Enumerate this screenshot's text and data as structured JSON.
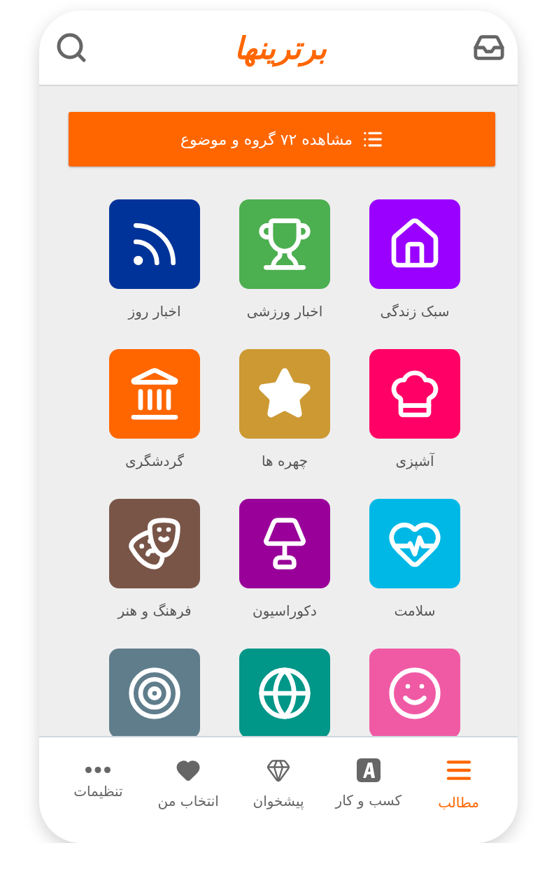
{
  "header": {
    "logo": "برترینها"
  },
  "topics_button": {
    "label": "مشاهده ۷۲ گروه و موضوع"
  },
  "categories": [
    {
      "kind": "lifestyle",
      "color": "#9900ff",
      "label": "سبک زندگی"
    },
    {
      "kind": "sports",
      "color": "#4caf50",
      "label": "اخبار ورزشی"
    },
    {
      "kind": "news",
      "color": "#003399",
      "label": "اخبار روز"
    },
    {
      "kind": "cooking",
      "color": "#ff0066",
      "label": "آشپزی"
    },
    {
      "kind": "celebrities",
      "color": "#cc9933",
      "label": "چهره ها"
    },
    {
      "kind": "tourism",
      "color": "#ff6600",
      "label": "گردشگری"
    },
    {
      "kind": "health",
      "color": "#00b8e6",
      "label": "سلامت"
    },
    {
      "kind": "decoration",
      "color": "#990099",
      "label": "دکوراسیون"
    },
    {
      "kind": "culture",
      "color": "#795548",
      "label": "فرهنگ و هنر"
    },
    {
      "kind": "fun",
      "color": "#f05aa5"
    },
    {
      "kind": "web",
      "color": "#009688"
    },
    {
      "kind": "goals",
      "color": "#607d8b"
    }
  ],
  "bottom_nav": [
    {
      "kind": "articles",
      "label": "مطالب",
      "selected": true
    },
    {
      "kind": "business",
      "label": "کسب و کار",
      "selected": false
    },
    {
      "kind": "counter",
      "label": "پیشخوان",
      "selected": false
    },
    {
      "kind": "favorites",
      "label": "انتخاب من",
      "selected": false
    },
    {
      "kind": "settings",
      "label": "تنظیمات",
      "selected": false
    }
  ]
}
